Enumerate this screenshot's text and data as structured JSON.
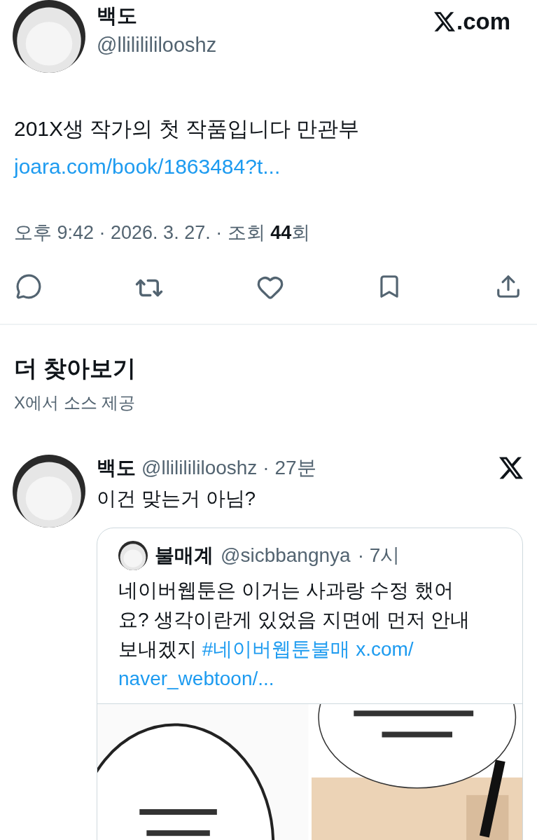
{
  "tweet": {
    "name": "백도",
    "handle": "@llililililooshz",
    "brand": ".com",
    "text": "201X생 작가의 첫 작품입니다 만관부",
    "link": "joara.com/book/1863484?t...",
    "meta": "오후 9:42 · 2026. 3. 27. · 조회 **44**회"
  },
  "more": {
    "title": "더 찾아보기",
    "subtitle": "X에서 소스 제공"
  },
  "reply": {
    "name": "백도",
    "handle": "@llililililooshz",
    "time": "· 27분",
    "text": "이건 맞는거 아님?",
    "quote": {
      "name": "불매계",
      "handle": "@sicbbangnya",
      "time": "· 7시",
      "text": "네이버웹툰은 이거는 사과랑 수정 했어요? 생각이란게 있었음 지면에 먼저 안내 보내겠지",
      "hashtag": "#네이버웹툰불매",
      "url_lines": [
        "x.com/",
        "naver_webtoon/..."
      ]
    }
  }
}
